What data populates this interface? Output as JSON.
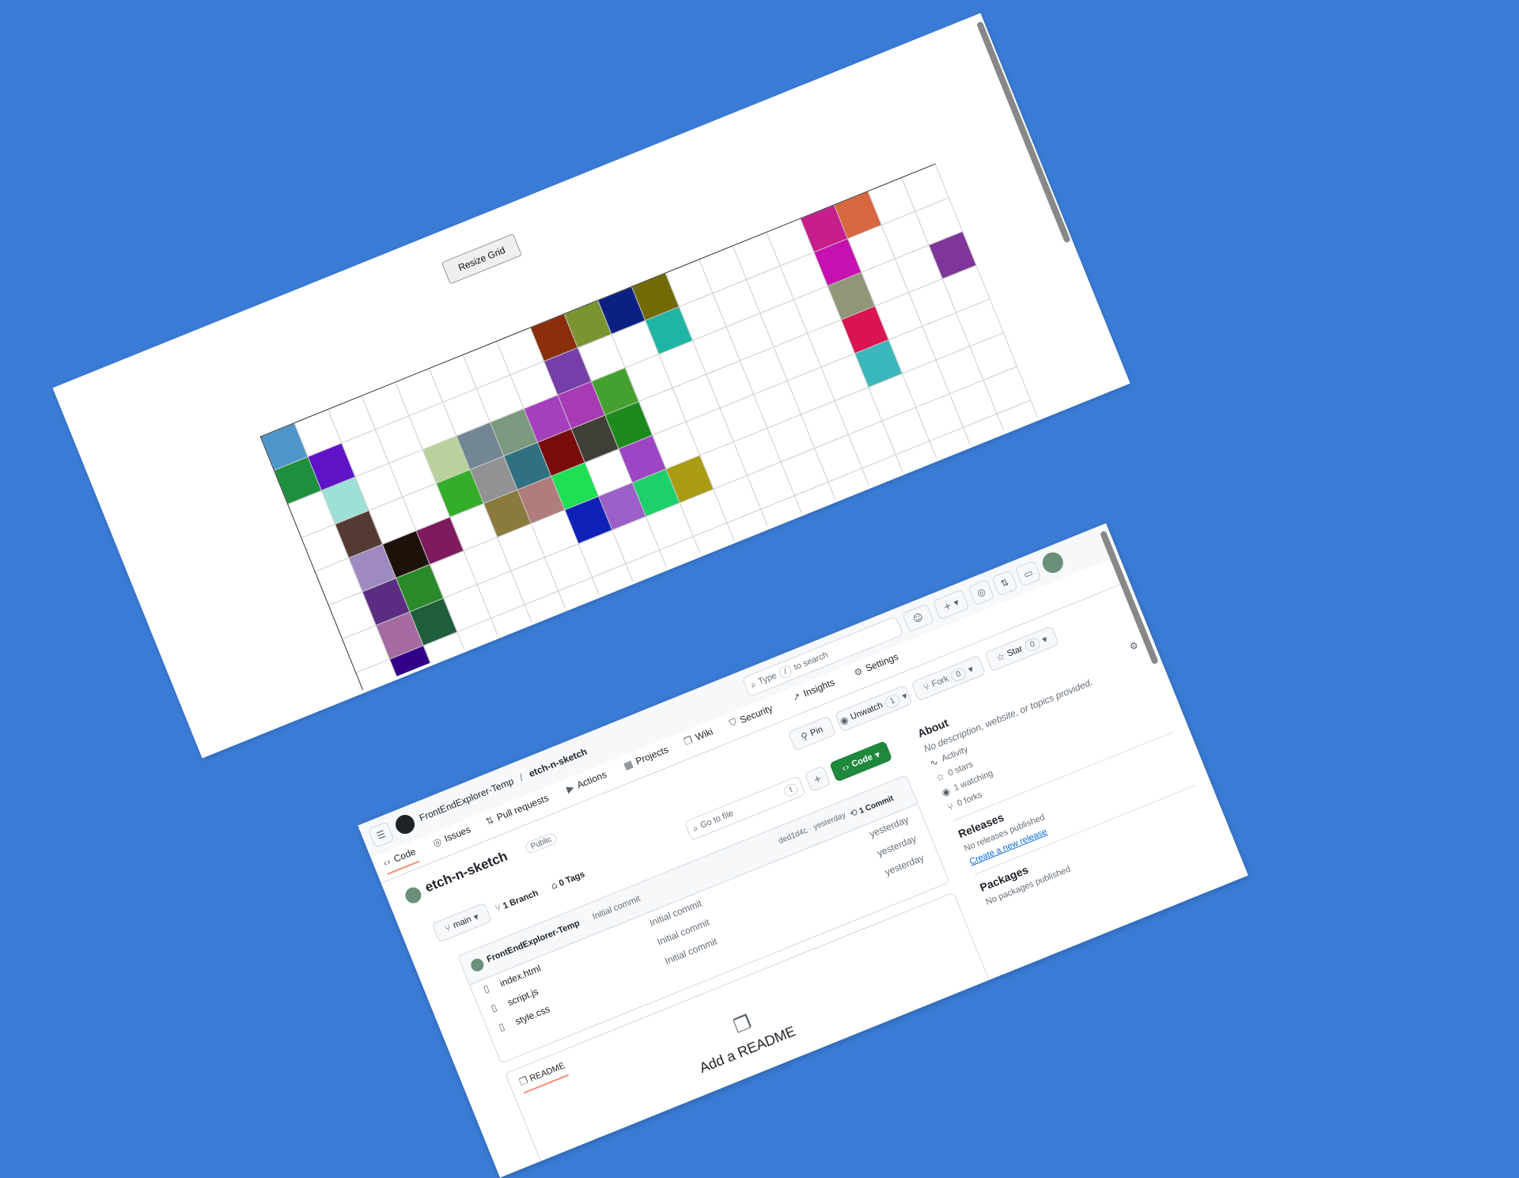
{
  "sketch": {
    "resize_label": "Resize Grid",
    "cells": [
      [
        0,
        0,
        "#4e95c9"
      ],
      [
        0,
        8,
        "#8a2e0c"
      ],
      [
        0,
        9,
        "#7a9431"
      ],
      [
        0,
        10,
        "#0c1f83"
      ],
      [
        0,
        11,
        "#716a06"
      ],
      [
        0,
        16,
        "#c61f8b"
      ],
      [
        0,
        17,
        "#d8663f"
      ],
      [
        0,
        20,
        "#a5643a"
      ],
      [
        1,
        0,
        "#1d8f3f"
      ],
      [
        1,
        1,
        "#5e13c7"
      ],
      [
        1,
        8,
        "#763ea8"
      ],
      [
        1,
        11,
        "#1fb5a5"
      ],
      [
        1,
        16,
        "#c611b0"
      ],
      [
        1,
        20,
        "#9c566a"
      ],
      [
        2,
        1,
        "#9de0d5"
      ],
      [
        2,
        4,
        "#b9d19c"
      ],
      [
        2,
        5,
        "#728694"
      ],
      [
        2,
        6,
        "#7a997e"
      ],
      [
        2,
        7,
        "#a53fbc"
      ],
      [
        2,
        8,
        "#a83ab5"
      ],
      [
        2,
        9,
        "#45a12f"
      ],
      [
        2,
        16,
        "#909678"
      ],
      [
        2,
        19,
        "#7f3599"
      ],
      [
        2,
        20,
        "#3bc08a"
      ],
      [
        3,
        1,
        "#553a33"
      ],
      [
        3,
        4,
        "#34ad28"
      ],
      [
        3,
        5,
        "#929295"
      ],
      [
        3,
        6,
        "#2f7081"
      ],
      [
        3,
        7,
        "#790b0b"
      ],
      [
        3,
        8,
        "#3f3f37"
      ],
      [
        3,
        9,
        "#1e8a1e"
      ],
      [
        3,
        16,
        "#d91450"
      ],
      [
        4,
        1,
        "#9e8ac1"
      ],
      [
        4,
        2,
        "#1d120a"
      ],
      [
        4,
        3,
        "#7e1a5d"
      ],
      [
        4,
        5,
        "#8a7a3b"
      ],
      [
        4,
        6,
        "#b07d7d"
      ],
      [
        4,
        7,
        "#1ee054"
      ],
      [
        4,
        9,
        "#9d45c4"
      ],
      [
        4,
        16,
        "#3ab7bb"
      ],
      [
        5,
        1,
        "#5b2d82"
      ],
      [
        5,
        2,
        "#2a8a2a"
      ],
      [
        5,
        7,
        "#0e22b8"
      ],
      [
        5,
        8,
        "#9c5fc8"
      ],
      [
        5,
        9,
        "#1dd06a"
      ],
      [
        5,
        10,
        "#a99b12"
      ],
      [
        6,
        1,
        "#a56aa0"
      ],
      [
        6,
        2,
        "#1f5e3c"
      ],
      [
        7,
        1,
        "#320088"
      ]
    ]
  },
  "github": {
    "breadcrumb": {
      "owner": "FrontEndExplorer-Temp",
      "separator": "/",
      "repo": "etch-n-sketch"
    },
    "search": {
      "prefix": "Type",
      "key": "/",
      "suffix": "to search"
    },
    "tabs": [
      "Code",
      "Issues",
      "Pull requests",
      "Actions",
      "Projects",
      "Wiki",
      "Security",
      "Insights",
      "Settings"
    ],
    "repo_title": "etch-n-sketch",
    "visibility": "Public",
    "actions": {
      "pin": "Pin",
      "unwatch": "Unwatch",
      "unwatch_count": "1",
      "fork": "Fork",
      "fork_count": "0",
      "star": "Star",
      "star_count": "0"
    },
    "branch": {
      "name": "main",
      "branches": "1 Branch",
      "tags": "0 Tags"
    },
    "go_to_file": {
      "placeholder": "Go to file",
      "key": "t"
    },
    "code_button": "Code",
    "commit": {
      "author": "FrontEndExplorer-Temp",
      "message": "Initial commit",
      "hash_time": "ded1d4c · yesterday",
      "count": "1 Commit"
    },
    "files": [
      {
        "name": "index.html",
        "message": "Initial commit",
        "time": "yesterday"
      },
      {
        "name": "script.js",
        "message": "Initial commit",
        "time": "yesterday"
      },
      {
        "name": "style.css",
        "message": "Initial commit",
        "time": "yesterday"
      }
    ],
    "readme_tab": "README",
    "add_readme": "Add a README",
    "about": {
      "title": "About",
      "description": "No description, website, or topics provided.",
      "activity": "Activity",
      "stars": "0 stars",
      "watching": "1 watching",
      "forks": "0 forks"
    },
    "releases": {
      "title": "Releases",
      "none": "No releases published",
      "create": "Create a new release"
    },
    "packages": {
      "title": "Packages",
      "none": "No packages published"
    }
  }
}
